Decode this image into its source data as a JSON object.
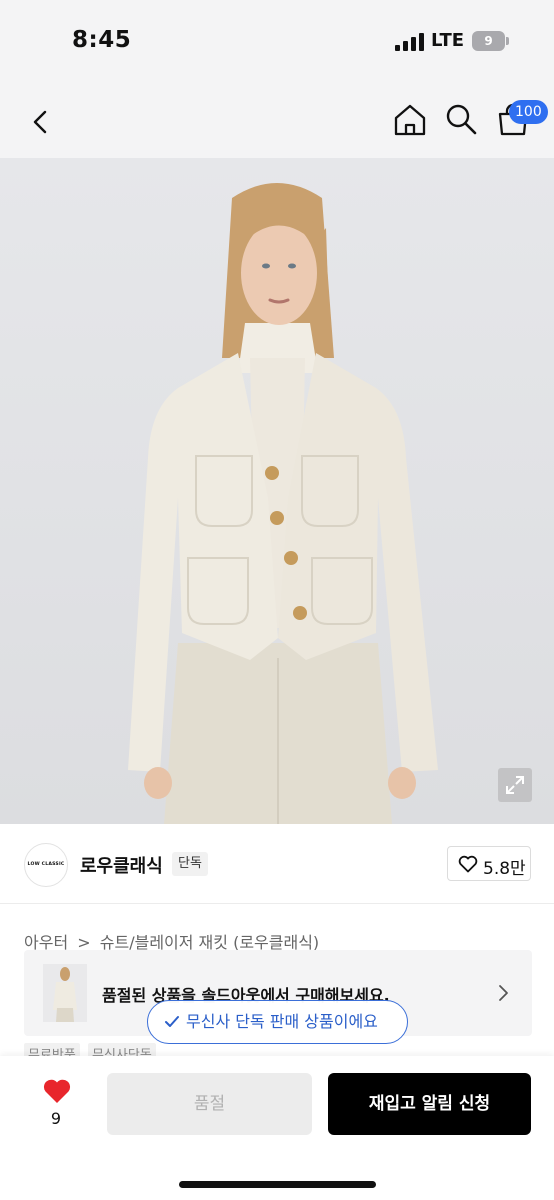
{
  "status_bar": {
    "time": "8:45",
    "network": "LTE",
    "battery_level": "9"
  },
  "nav": {
    "icons": [
      "back-icon",
      "home-icon",
      "search-icon",
      "cart-icon"
    ],
    "cart_badge": "100"
  },
  "hero": {
    "expand_icon": "expand-icon"
  },
  "brand": {
    "logo_text": "LOW CLASSIC",
    "name": "로우클래식",
    "badge": "단독",
    "like_count": "5.8만"
  },
  "breadcrumb": {
    "items": [
      "아우터",
      ">",
      "슈트/블레이저 재킷 (로우클래식)"
    ]
  },
  "soldout_banner": {
    "text": "품절된 상품을 솔드아웃에서 구매해보세요."
  },
  "tags": [
    "무료반품",
    "무신사단독"
  ],
  "tooltip": {
    "text": "무신사 단독 판매 상품이에요"
  },
  "bottom_bar": {
    "wish_count": "9",
    "soldout_label": "품절",
    "restock_label": "재입고 알림 신청"
  },
  "colors": {
    "accent_blue": "#2f6ff0",
    "heart_red": "#e8262c",
    "primary_button": "#000000"
  }
}
